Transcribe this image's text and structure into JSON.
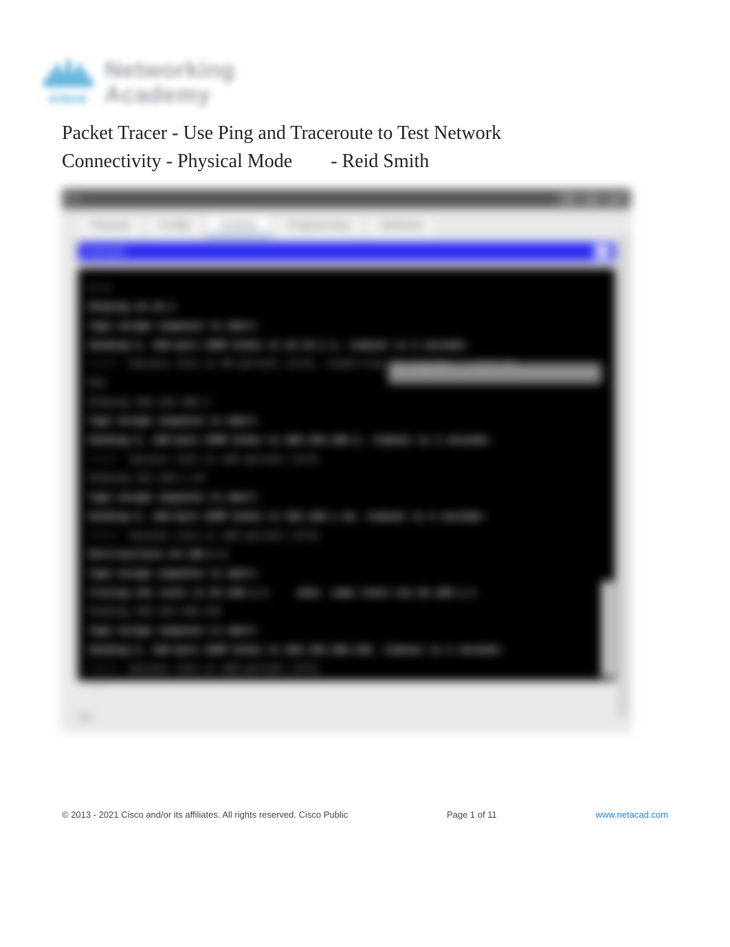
{
  "logo": {
    "word_top": "Networking",
    "word_bot": "Academy",
    "brand": "cisco"
  },
  "title_line1": "Packet Tracer - Use Ping and Traceroute to Test Network",
  "title_line2": "Connectivity - Physical Mode",
  "title_author": "- Reid Smith",
  "window": {
    "title": "PC",
    "tabs": [
      "Physical",
      "Config",
      "Desktop",
      "Programming",
      "Attributes"
    ],
    "active_tab": 2,
    "strip_label": "Command"
  },
  "terminal": {
    "lines": [
      "C:\\>",
      "R1#ping 10.10.1",
      "",
      "Type escape sequence to abort.",
      "Sending 5, 100-byte ICMP Echos to 10.10.1.1, timeout is 2 seconds:",
      "!!!!!  Success rate is 80 percent (4/5), round-trip min/avg/max = 1/2/3 ms",
      "",
      "R1#",
      "R1#ping 209.165.200.2",
      "",
      "Type escape sequence to abort.",
      "Sending 5, 100-byte ICMP Echos to 209.165.200.2, timeout is 2 seconds:",
      "!!!!!  Success rate is 100 percent (5/5)",
      "R1#ping 192.168.1.10",
      "",
      "Type escape sequence to abort.",
      "Sending 5, 100-byte ICMP Echos to 192.168.1.10, timeout is 2 seconds:",
      "!!!!!  Success rate is 100 percent (5/5)",
      "",
      "R1#traceroute 64.100.1.1",
      "Type escape sequence to abort.",
      "Tracing the route to 64.100.1.1     show  some route via 64.100.1.1",
      "",
      "R1#ping 209.165.200.225",
      "",
      "Type escape sequence to abort.",
      "Sending 5, 100-byte ICMP Echos to 209.165.200.225, timeout is 2 seconds:",
      "!!!!!  Success rate is 100 percent (5/5)",
      "R1#"
    ]
  },
  "bottom_label": "Top",
  "footer": {
    "copyright": "©  2013 - 2021 Cisco and/or its affiliates. All rights reserved. Cisco Public",
    "page": "Page   1  of  11",
    "link": "www.netacad.com"
  }
}
